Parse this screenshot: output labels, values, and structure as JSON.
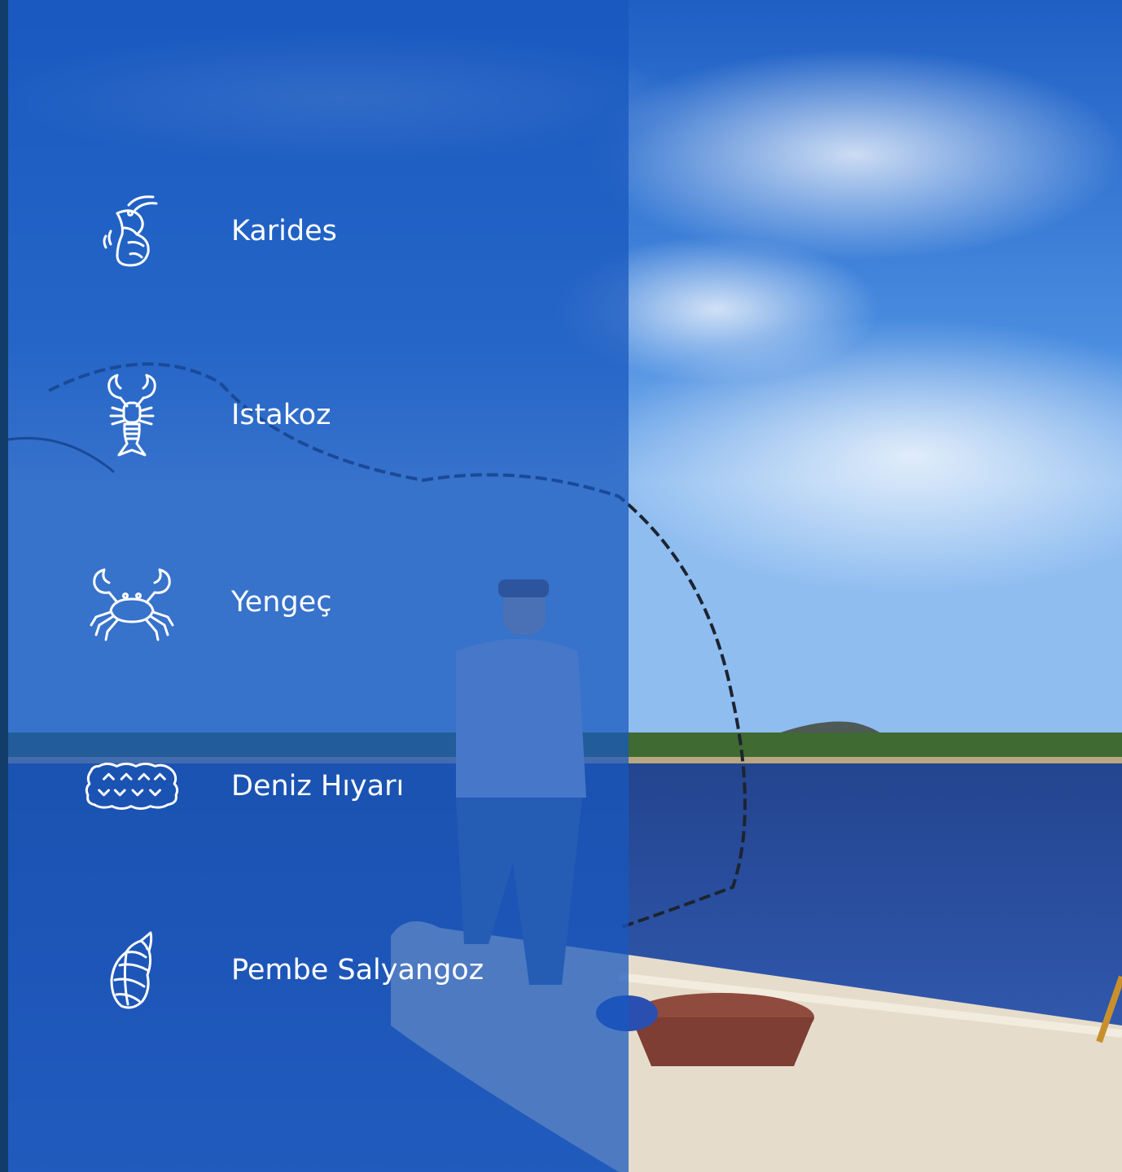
{
  "background": {
    "sky_color": "#2a66c8",
    "water_color": "#2c4fa0",
    "overlay_color": "#1858be"
  },
  "species": [
    {
      "label": "Karides",
      "icon": "shrimp-icon"
    },
    {
      "label": "Istakoz",
      "icon": "lobster-icon"
    },
    {
      "label": "Yengeç",
      "icon": "crab-icon"
    },
    {
      "label": "Deniz Hıyarı",
      "icon": "sea-cucumber-icon"
    },
    {
      "label": "Pembe Salyangoz",
      "icon": "conch-shell-icon"
    }
  ]
}
